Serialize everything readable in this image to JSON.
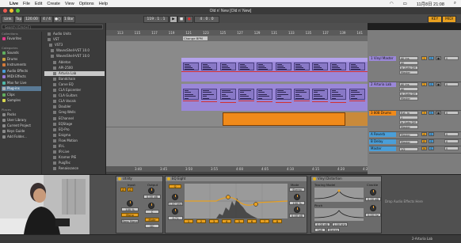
{
  "menubar": {
    "app": "Live",
    "items": [
      "File",
      "Edit",
      "Create",
      "View",
      "Options",
      "Help"
    ],
    "clock": "11月8日 21:08"
  },
  "window": {
    "title": "Old n' New  [Old n' New]"
  },
  "control": {
    "link": "Link",
    "tap": "Tap",
    "tempo": "120.00",
    "meter": "4 / 4",
    "metronome": "●○",
    "quantize": "1 Bar",
    "position": "119 . 1 . 1",
    "end": "4 . 0 . 0",
    "transport_play": "▶",
    "transport_stop": "■",
    "transport_rec": "●"
  },
  "browser": {
    "search_placeholder": "Search (Cmd+F)",
    "collections_heading": "Collections",
    "favorites": "Favorites",
    "categories_heading": "Categories",
    "categories": [
      "Sounds",
      "Drums",
      "Instruments",
      "Audio Effects",
      "MIDI Effects",
      "Max for Live",
      "Plug-ins",
      "Clips",
      "Samples"
    ],
    "selected_category": "Plug-ins",
    "places_heading": "Places",
    "places": [
      "Packs",
      "User Library",
      "Current Project",
      "Keys Guide",
      "Add Folder..."
    ],
    "files": [
      "Audio Units",
      "VST",
      "VST3",
      "WavesShell-VST 10.0",
      "WavesShell-VST 10.0",
      "Ableton",
      "API-2500",
      "Arturia Lab",
      "Bandchain",
      "Carve EQ",
      "CLA Epicenter",
      "CLA Guitars",
      "CLA Vocals",
      "Doubler",
      "Greg Wells",
      "EChannel",
      "EQStage",
      "EQ-Pro",
      "Enigma",
      "Flow Motion",
      "IR-L",
      "IR-Live",
      "Kramer PIE",
      "PuigTec",
      "Renaissance"
    ],
    "selected_file": "Arturia Lab"
  },
  "arrangement": {
    "bars": [
      "113",
      "115",
      "117",
      "119",
      "121",
      "123",
      "125",
      "127",
      "129",
      "131",
      "133",
      "135",
      "137",
      "139",
      "141"
    ],
    "locator": "Change BPM",
    "bottom_times": [
      "3:40",
      "3:45",
      "3:50",
      "3:55",
      "4:00",
      "4:05",
      "4:10",
      "4:15",
      "4:20",
      "4:25"
    ],
    "zoom_label": "1/1"
  },
  "tracks": [
    {
      "name": "1 Vinyl Master",
      "color": "#9a87d8",
      "input": "All Ins",
      "channel": "All Channels",
      "monitor": "In Auto Off",
      "out": "Master",
      "num": "1"
    },
    {
      "name": "2 Arturia Lab",
      "color": "#9a87d8",
      "input": "All Ins",
      "channel": "All Channels",
      "monitor": "In Auto Off",
      "out": "Master",
      "num": "2"
    },
    {
      "name": "3 808 Drums",
      "color": "#f08a1a",
      "input": "Ext. In",
      "channel": "1",
      "monitor": "In Auto Off",
      "out": "Master",
      "num": "3"
    },
    {
      "name": "A Reverb",
      "color": "#4a9ed8",
      "out": "Master",
      "num": "A"
    },
    {
      "name": "B Delay",
      "color": "#4a9ed8",
      "out": "Master",
      "num": "B"
    },
    {
      "name": "Master",
      "color": "#4a9ed8",
      "out": "1/2",
      "num": "M"
    }
  ],
  "devices": {
    "utility": {
      "title": "Utility",
      "input_label": "Input",
      "output_label": "Output",
      "gain": "0.00 dB",
      "width": "100 %",
      "bass_mono": "Bass Mono",
      "balance": "C",
      "mono": "Mono",
      "dc": "DC",
      "mute": "Mute"
    },
    "eq8": {
      "title": "EQ Eight",
      "mode": "Stereo",
      "scale": "100 %",
      "gain": "0.00 dB",
      "freq": "1.00 kHz",
      "q": "0.71",
      "bands": [
        "1",
        "2",
        "3",
        "4",
        "5",
        "6",
        "7",
        "8"
      ]
    },
    "vinyl": {
      "title": "Vinyl Distortion",
      "tracing_label": "Tracing Model",
      "pinch_label": "Pinch",
      "crackle_label": "Crackle",
      "drive": "0.00 dB",
      "freq": "1.00 kHz",
      "volume": "0.00 dB",
      "density": "0.00 Hz",
      "soft": "Soft",
      "stereo": "Stereo"
    },
    "drop_hint": "Drop Audio Effects Here"
  },
  "status": {
    "text": "2-Arturia Lab"
  }
}
